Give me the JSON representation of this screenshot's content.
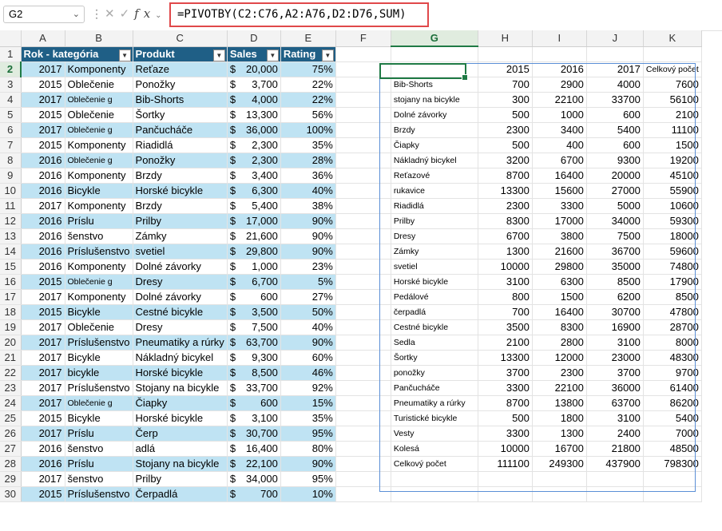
{
  "formula_bar": {
    "name_box": "G2",
    "formula": "=PIVOTBY(C2:C76,A2:A76,D2:D76,SUM)",
    "fx_label": "fx"
  },
  "columns": [
    "A",
    "B",
    "C",
    "D",
    "E",
    "F",
    "G",
    "H",
    "I",
    "J",
    "K"
  ],
  "row_numbers": [
    "1",
    "2",
    "3",
    "4",
    "5",
    "6",
    "7",
    "8",
    "9",
    "10",
    "11",
    "12",
    "13",
    "14",
    "15",
    "16",
    "17",
    "18",
    "19",
    "20",
    "21",
    "22",
    "23",
    "24",
    "25",
    "26",
    "27",
    "28",
    "29",
    "30"
  ],
  "table_headers": [
    "Rok - kategória",
    "Produkt",
    "Sales",
    "Rating"
  ],
  "source_rows": [
    {
      "year": "2017",
      "cat": "Komponenty",
      "prod": "Reťaze",
      "dollar": "$",
      "sales": "20,000",
      "rating": "75%"
    },
    {
      "year": "2015",
      "cat": "Oblečenie",
      "prod": "Ponožky",
      "dollar": "$",
      "sales": "3,700",
      "rating": "22%"
    },
    {
      "year": "2017",
      "cat": "Oblečenie g",
      "prod": "Bib-Shorts",
      "dollar": "$",
      "sales": "4,000",
      "rating": "22%"
    },
    {
      "year": "2015",
      "cat": "Oblečenie",
      "prod": "Šortky",
      "dollar": "$",
      "sales": "13,300",
      "rating": "56%"
    },
    {
      "year": "2017",
      "cat": "Oblečenie g",
      "prod": "Pančucháče",
      "dollar": "$",
      "sales": "36,000",
      "rating": "100%"
    },
    {
      "year": "2015",
      "cat": "Komponenty",
      "prod": "Riadidlá",
      "dollar": "$",
      "sales": "2,300",
      "rating": "35%"
    },
    {
      "year": "2016",
      "cat": "Oblečenie g",
      "prod": "Ponožky",
      "dollar": "$",
      "sales": "2,300",
      "rating": "28%"
    },
    {
      "year": "2016",
      "cat": "Komponenty",
      "prod": "Brzdy",
      "dollar": "$",
      "sales": "3,400",
      "rating": "36%"
    },
    {
      "year": "2016",
      "cat": "Bicykle",
      "prod": "Horské bicykle",
      "dollar": "$",
      "sales": "6,300",
      "rating": "40%"
    },
    {
      "year": "2017",
      "cat": "Komponenty",
      "prod": "Brzdy",
      "dollar": "$",
      "sales": "5,400",
      "rating": "38%"
    },
    {
      "year": "2016",
      "cat": "Príslu",
      "prod": "Prilby",
      "dollar": "$",
      "sales": "17,000",
      "rating": "90%"
    },
    {
      "year": "2016",
      "cat": "šenstvo",
      "prod": "Zámky",
      "dollar": "$",
      "sales": "21,600",
      "rating": "90%"
    },
    {
      "year": "2016",
      "cat": "Príslušenstvo",
      "prod": "svetiel",
      "dollar": "$",
      "sales": "29,800",
      "rating": "90%"
    },
    {
      "year": "2016",
      "cat": "Komponenty",
      "prod": "Dolné závorky",
      "dollar": "$",
      "sales": "1,000",
      "rating": "23%"
    },
    {
      "year": "2015",
      "cat": "Oblečenie g",
      "prod": "Dresy",
      "dollar": "$",
      "sales": "6,700",
      "rating": "5%"
    },
    {
      "year": "2017",
      "cat": "Komponenty",
      "prod": "Dolné závorky",
      "dollar": "$",
      "sales": "600",
      "rating": "27%"
    },
    {
      "year": "2015",
      "cat": "Bicykle",
      "prod": "Cestné bicykle",
      "dollar": "$",
      "sales": "3,500",
      "rating": "50%"
    },
    {
      "year": "2017",
      "cat": "Oblečenie",
      "prod": "Dresy",
      "dollar": "$",
      "sales": "7,500",
      "rating": "40%"
    },
    {
      "year": "2017",
      "cat": "Príslušenstvo",
      "prod": "Pneumatiky a rúrky",
      "dollar": "$",
      "sales": "63,700",
      "rating": "90%"
    },
    {
      "year": "2017",
      "cat": "Bicykle",
      "prod": "Nákladný bicykel",
      "dollar": "$",
      "sales": "9,300",
      "rating": "60%"
    },
    {
      "year": "2017",
      "cat": "bicykle",
      "prod": "Horské bicykle",
      "dollar": "$",
      "sales": "8,500",
      "rating": "46%"
    },
    {
      "year": "2017",
      "cat": "Príslušenstvo",
      "prod": "Stojany na bicykle",
      "dollar": "$",
      "sales": "33,700",
      "rating": "92%"
    },
    {
      "year": "2017",
      "cat": "Oblečenie g",
      "prod": "Čiapky",
      "dollar": "$",
      "sales": "600",
      "rating": "15%"
    },
    {
      "year": "2015",
      "cat": "Bicykle",
      "prod": "Horské bicykle",
      "dollar": "$",
      "sales": "3,100",
      "rating": "35%"
    },
    {
      "year": "2017",
      "cat": "Príslu",
      "prod": "Čerp",
      "dollar": "$",
      "sales": "30,700",
      "rating": "95%"
    },
    {
      "year": "2016",
      "cat": "šenstvo",
      "prod": "adlá",
      "dollar": "$",
      "sales": "16,400",
      "rating": "80%"
    },
    {
      "year": "2016",
      "cat": "Príslu",
      "prod": "Stojany na bicykle",
      "dollar": "$",
      "sales": "22,100",
      "rating": "90%"
    },
    {
      "year": "2017",
      "cat": "šenstvo",
      "prod": "Prilby",
      "dollar": "$",
      "sales": "34,000",
      "rating": "95%"
    },
    {
      "year": "2015",
      "cat": "Príslušenstvo",
      "prod": "Čerpadlá",
      "dollar": "$",
      "sales": "700",
      "rating": "10%"
    }
  ],
  "pivot": {
    "headers": [
      "",
      "2015",
      "2016",
      "2017",
      "Celkový počet"
    ],
    "rows": [
      [
        "Bib-Shorts",
        "700",
        "2900",
        "4000",
        "7600"
      ],
      [
        "stojany na bicykle",
        "300",
        "22100",
        "33700",
        "56100"
      ],
      [
        "Dolné závorky",
        "500",
        "1000",
        "600",
        "2100"
      ],
      [
        "Brzdy",
        "2300",
        "3400",
        "5400",
        "11100"
      ],
      [
        "Čiapky",
        "500",
        "400",
        "600",
        "1500"
      ],
      [
        "Nákladný bicykel",
        "3200",
        "6700",
        "9300",
        "19200"
      ],
      [
        "Reťazové",
        "8700",
        "16400",
        "20000",
        "45100"
      ],
      [
        "rukavice",
        "13300",
        "15600",
        "27000",
        "55900"
      ],
      [
        "Riadidlá",
        "2300",
        "3300",
        "5000",
        "10600"
      ],
      [
        "Prilby",
        "8300",
        "17000",
        "34000",
        "59300"
      ],
      [
        "Dresy",
        "6700",
        "3800",
        "7500",
        "18000"
      ],
      [
        "Zámky",
        "1300",
        "21600",
        "36700",
        "59600"
      ],
      [
        "svetiel",
        "10000",
        "29800",
        "35000",
        "74800"
      ],
      [
        "Horské bicykle",
        "3100",
        "6300",
        "8500",
        "17900"
      ],
      [
        "Pedálové",
        "800",
        "1500",
        "6200",
        "8500"
      ],
      [
        "čerpadlá",
        "700",
        "16400",
        "30700",
        "47800"
      ],
      [
        "Cestné bicykle",
        "3500",
        "8300",
        "16900",
        "28700"
      ],
      [
        "Sedla",
        "2100",
        "2800",
        "3100",
        "8000"
      ],
      [
        "Šortky",
        "13300",
        "12000",
        "23000",
        "48300"
      ],
      [
        "ponožky",
        "3700",
        "2300",
        "3700",
        "9700"
      ],
      [
        "Pančucháče",
        "3300",
        "22100",
        "36000",
        "61400"
      ],
      [
        "Pneumatiky a rúrky",
        "8700",
        "13800",
        "63700",
        "86200"
      ],
      [
        "Turistické bicykle",
        "500",
        "1800",
        "3100",
        "5400"
      ],
      [
        "Vesty",
        "3300",
        "1300",
        "2400",
        "7000"
      ],
      [
        "Kolesá",
        "10000",
        "16700",
        "21800",
        "48500"
      ],
      [
        "Celkový počet",
        "111100",
        "249300",
        "437900",
        "798300"
      ]
    ]
  }
}
